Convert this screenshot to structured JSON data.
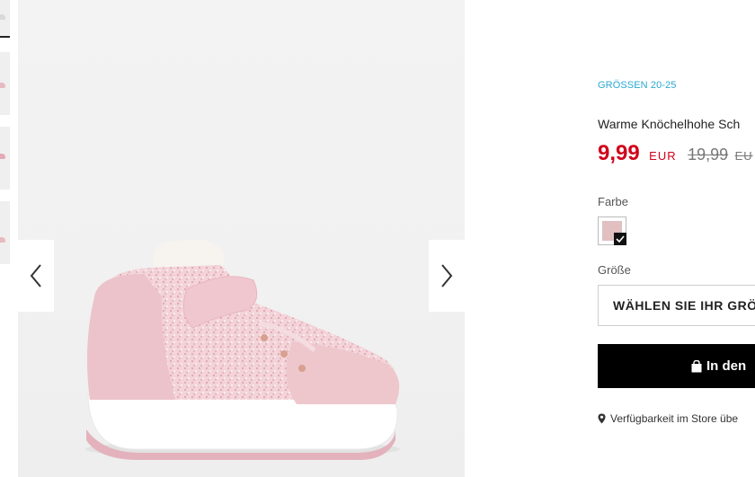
{
  "product": {
    "size_range": "GRÖSSEN 20-25",
    "title": "Warme Knöchelhohe Sch",
    "price": "9,99",
    "currency": "EUR",
    "old_price": "19,99",
    "old_currency": "EU"
  },
  "options": {
    "color_label": "Farbe",
    "selected_color": "#e2bfc0",
    "size_label": "Größe",
    "size_select_placeholder": "WÄHLEN SIE IHR GRÖ"
  },
  "actions": {
    "add_to_cart": "In den"
  },
  "store": {
    "availability": "Verfügbarkeit im Store übe"
  },
  "gallery": {
    "prev_icon": "chevron-left-icon",
    "next_icon": "chevron-right-icon",
    "accent_color": "#d0021b",
    "link_color": "#2aa8d2"
  }
}
